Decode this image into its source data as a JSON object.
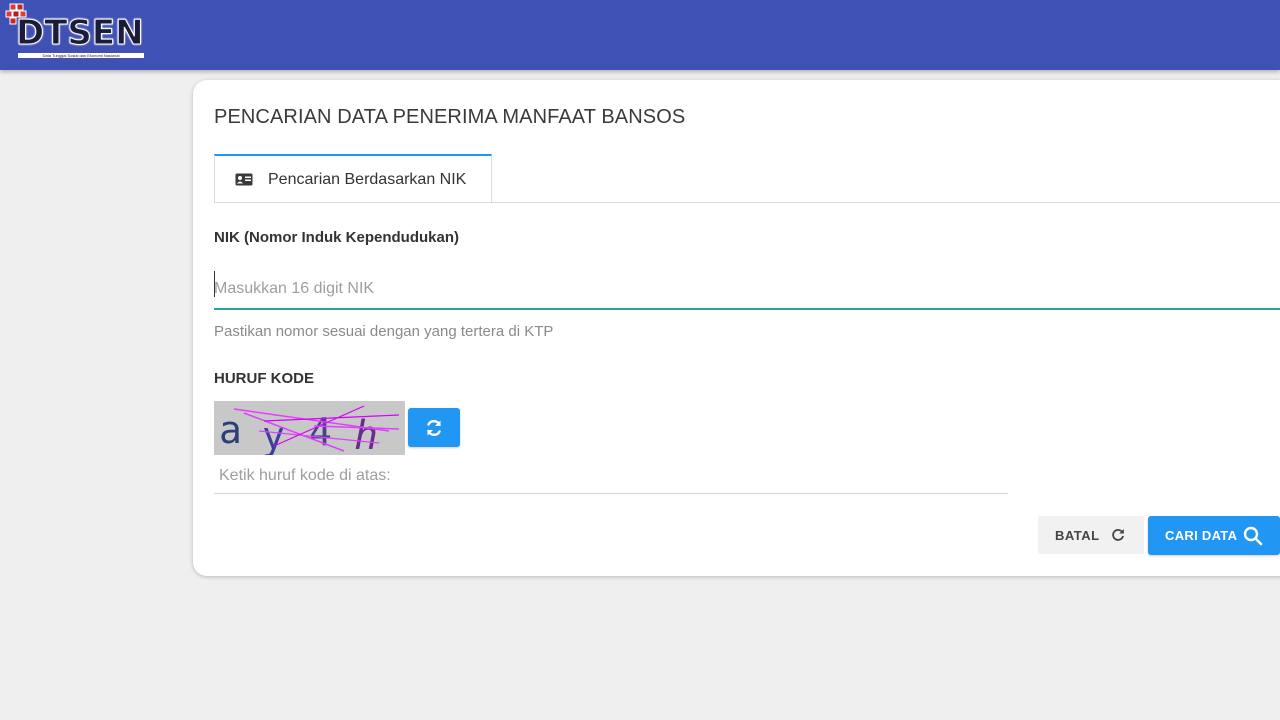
{
  "brand": {
    "name": "DTSEN",
    "tagline": "Data Tunggal Sosial dan Ekonomi Nasional"
  },
  "page": {
    "title": "PENCARIAN DATA PENERIMA MANFAAT BANSOS"
  },
  "tabs": [
    {
      "label": "Pencarian Berdasarkan NIK",
      "icon": "id-card-icon",
      "active": true
    }
  ],
  "nik_field": {
    "label": "NIK (Nomor Induk Kependudukan)",
    "placeholder": "Masukkan 16 digit NIK",
    "value": "",
    "helper": "Pastikan nomor sesuai dengan yang tertera di KTP"
  },
  "captcha": {
    "label": "HURUF KODE",
    "code_chars": [
      "a",
      "y",
      "4",
      "h"
    ],
    "input_placeholder": "Ketik huruf kode di atas:",
    "refresh_icon": "refresh-icon"
  },
  "actions": {
    "cancel_label": "BATAL",
    "cancel_icon": "reload-icon",
    "search_label": "CARI DATA",
    "search_icon": "search-icon"
  },
  "colors": {
    "header": "#3f51b5",
    "primary": "#2196f3",
    "input_focus": "#26a69a",
    "background": "#efefef"
  }
}
